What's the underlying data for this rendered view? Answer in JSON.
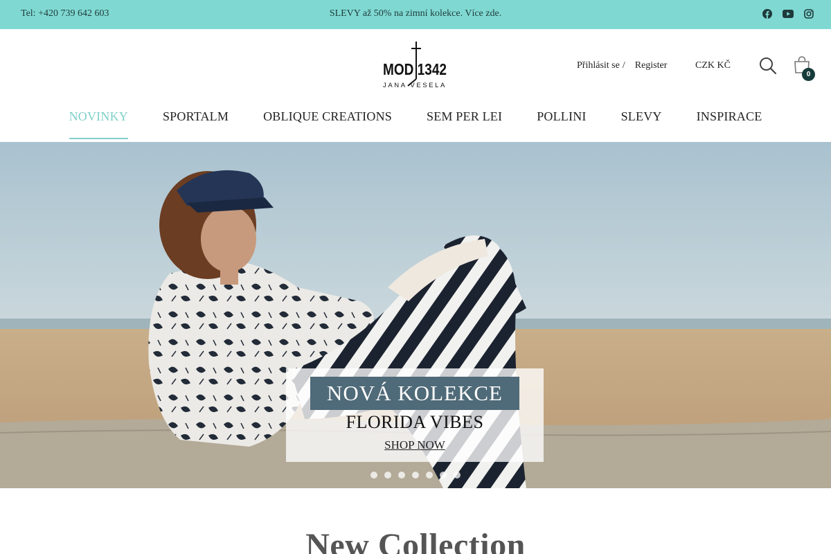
{
  "topbar": {
    "phone": "Tel: +420 739 642 603",
    "promo": "SLEVY až 50% na zimní kolekce. Více zde.",
    "social_icons": [
      "facebook-icon",
      "youtube-icon",
      "instagram-icon"
    ]
  },
  "brand": {
    "logo_text_top": "MOD 1342",
    "logo_text_bottom": "JANA VESELA"
  },
  "account": {
    "login": "Přihlásit se",
    "separator": "/",
    "register": "Register"
  },
  "currency": "CZK KČ",
  "cart": {
    "count": "0"
  },
  "nav": {
    "items": [
      {
        "label": "NOVINKY",
        "active": true
      },
      {
        "label": "SPORTALM"
      },
      {
        "label": "OBLIQUE CREATIONS"
      },
      {
        "label": "SEM PER LEI"
      },
      {
        "label": "POLLINI"
      },
      {
        "label": "SLEVY"
      },
      {
        "label": "INSPIRACE"
      }
    ]
  },
  "hero": {
    "headline": "NOVÁ KOLEKCE",
    "subheadline": "FLORIDA VIBES",
    "cta": "SHOP NOW",
    "slide_count": 7,
    "active_slide": 6
  },
  "section": {
    "title": "New Collection"
  },
  "colors": {
    "accent": "#7fd9d2",
    "nav_active": "#7fd0c9",
    "badge": "#173b3b",
    "headline_bg": "#4f6a78"
  }
}
